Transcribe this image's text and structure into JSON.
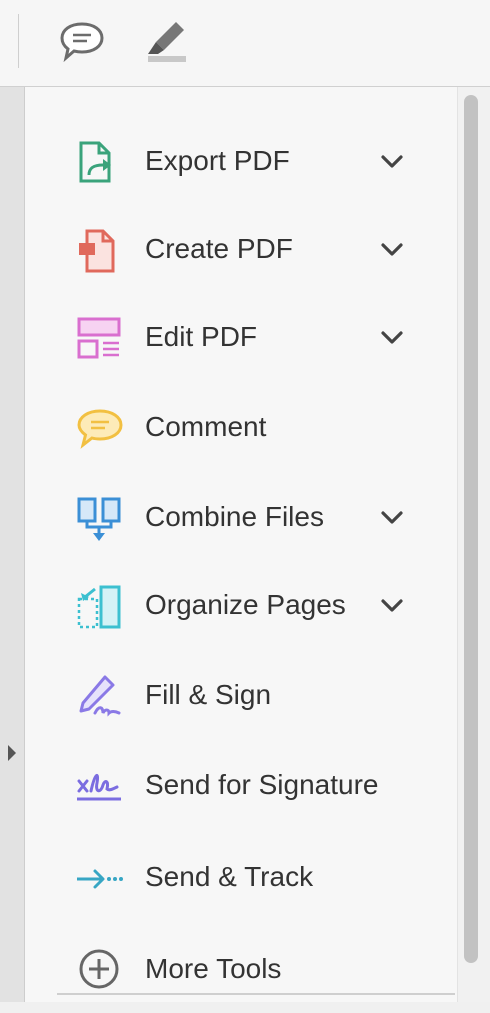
{
  "toolbar": {
    "icons": [
      "comment-bubble-icon",
      "highlighter-icon"
    ]
  },
  "tools": [
    {
      "label": "Export PDF",
      "icon": "export-pdf-icon",
      "has_chevron": true
    },
    {
      "label": "Create PDF",
      "icon": "create-pdf-icon",
      "has_chevron": true
    },
    {
      "label": "Edit PDF",
      "icon": "edit-pdf-icon",
      "has_chevron": true
    },
    {
      "label": "Comment",
      "icon": "comment-icon",
      "has_chevron": false
    },
    {
      "label": "Combine Files",
      "icon": "combine-files-icon",
      "has_chevron": true
    },
    {
      "label": "Organize Pages",
      "icon": "organize-pages-icon",
      "has_chevron": true
    },
    {
      "label": "Fill & Sign",
      "icon": "fill-sign-icon",
      "has_chevron": false
    },
    {
      "label": "Send for Signature",
      "icon": "send-for-signature-icon",
      "has_chevron": false
    },
    {
      "label": "Send & Track",
      "icon": "send-track-icon",
      "has_chevron": false
    },
    {
      "label": "More Tools",
      "icon": "more-tools-icon",
      "has_chevron": false
    }
  ],
  "colors": {
    "export": "#3aa37b",
    "create": "#e0695c",
    "edit": "#d96fcf",
    "comment": "#f2c042",
    "combine": "#3b8fd6",
    "organize": "#3cc0d0",
    "fill_sign": "#8a79e6",
    "send_signature": "#7b6de0",
    "send_track": "#37a6c4",
    "more_tools": "#666666"
  }
}
